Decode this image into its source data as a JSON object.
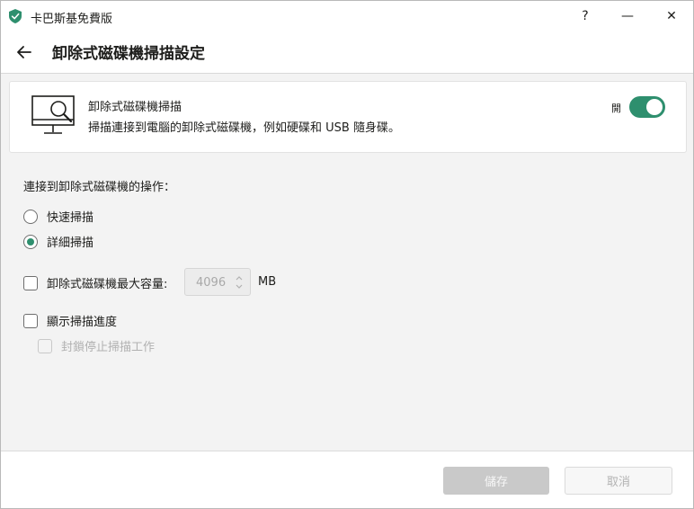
{
  "window": {
    "title": "卡巴斯基免費版",
    "help_label": "?",
    "minimize_label": "—",
    "close_label": "✕"
  },
  "header": {
    "title": "卸除式磁碟機掃描設定"
  },
  "feature": {
    "title": "卸除式磁碟機掃描",
    "description": "掃描連接到電腦的卸除式磁碟機，例如硬碟和 USB 隨身碟。",
    "toggle_label": "開",
    "enabled": true
  },
  "options": {
    "section_label": "連接到卸除式磁碟機的操作：",
    "quick_scan_label": "快速掃描",
    "full_scan_label": "詳細掃描",
    "selected": "full_scan",
    "max_size_label": "卸除式磁碟機最大容量:",
    "max_size_value": "4096",
    "max_size_unit": "MB",
    "max_size_checked": false,
    "show_progress_label": "顯示掃描進度",
    "show_progress_checked": false,
    "block_stop_label": "封鎖停止掃描工作",
    "block_stop_checked": false
  },
  "footer": {
    "save_label": "儲存",
    "cancel_label": "取消"
  },
  "colors": {
    "accent": "#2e8f6e",
    "disabled_button": "#c9c9c9"
  }
}
